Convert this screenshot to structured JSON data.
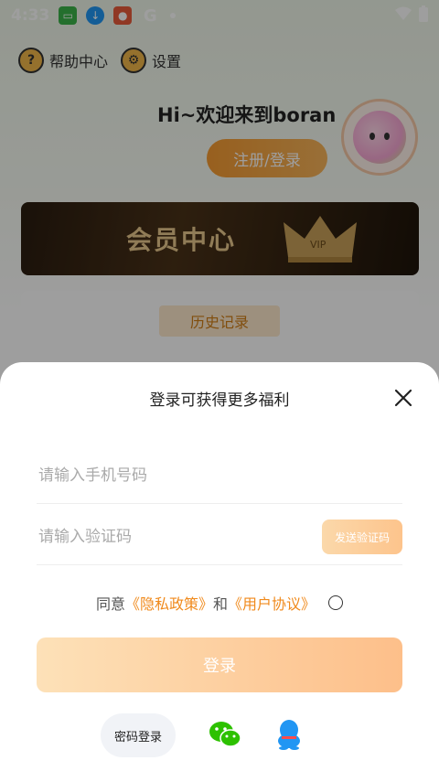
{
  "status_bar": {
    "time": "4:33"
  },
  "top_nav": {
    "help_label": "帮助中心",
    "settings_label": "设置"
  },
  "profile": {
    "greeting": "Hi~欢迎来到boran",
    "register_label": "注册/登录"
  },
  "vip": {
    "title": "会员中心",
    "crown_text": "VIP"
  },
  "history": {
    "label": "历史记录"
  },
  "login_sheet": {
    "title": "登录可获得更多福利",
    "phone_placeholder": "请输入手机号码",
    "code_placeholder": "请输入验证码",
    "send_code_label": "发送验证码",
    "agree_prefix": "同意",
    "privacy_link": "《隐私政策》",
    "and_text": "和",
    "user_agreement_link": "《用户协议》",
    "login_label": "登录",
    "password_login_label": "密码登录"
  },
  "colors": {
    "accent": "#f08a1c",
    "login_gradient_start": "#fde1b8",
    "login_gradient_end": "#fdbf8a"
  }
}
